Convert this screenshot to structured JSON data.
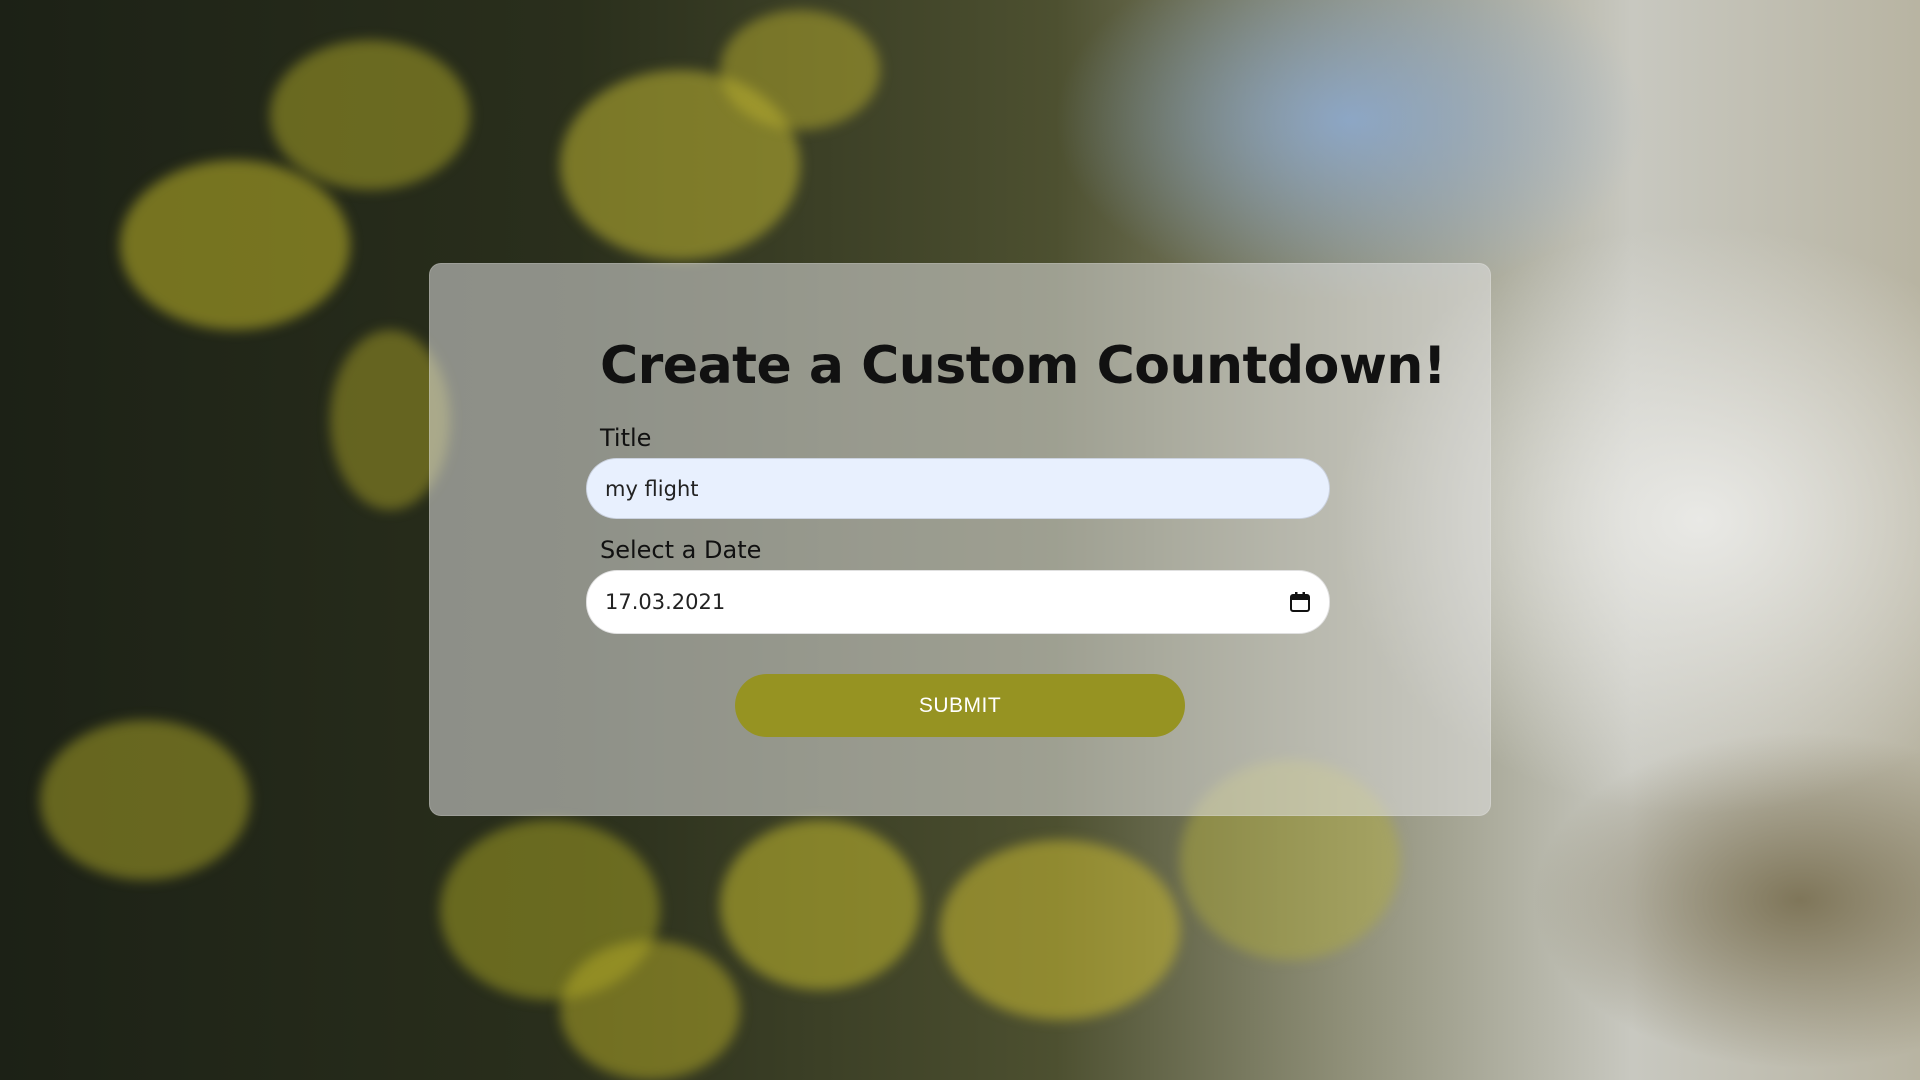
{
  "form": {
    "heading": "Create a Custom Countdown!",
    "title_label": "Title",
    "title_value": "my flight",
    "date_label": "Select a Date",
    "date_value": "17.03.2021",
    "submit_label": "SUBMIT"
  },
  "icons": {
    "date_picker": "calendar-icon"
  },
  "colors": {
    "accent": "#969322",
    "title_field_bg": "#e8f0fe",
    "date_field_bg": "#ffffff",
    "card_overlay": "#e1e1e1"
  }
}
